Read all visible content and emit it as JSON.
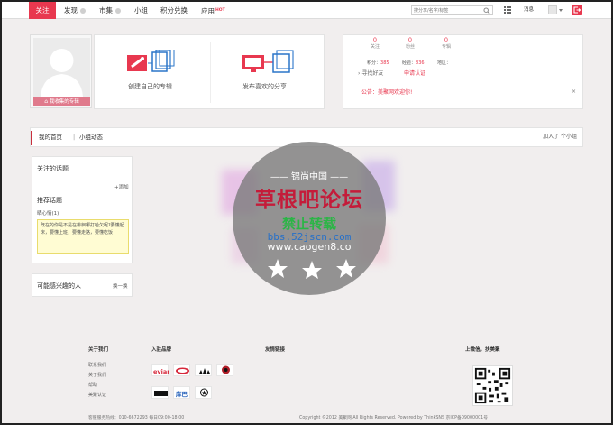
{
  "nav": {
    "items": [
      {
        "label": "关注",
        "active": true
      },
      {
        "label": "发现",
        "active": false
      },
      {
        "label": "市集",
        "active": false
      },
      {
        "label": "小组",
        "active": false
      },
      {
        "label": "积分兑换",
        "active": false
      },
      {
        "label": "应用",
        "active": false,
        "badge": "HOT"
      }
    ],
    "search": {
      "placeholder": "搜分享/名字/标签"
    },
    "messages_label": "消息",
    "icons": {
      "search": "search-icon",
      "grid": "grid-icon",
      "exit": "exit-icon"
    }
  },
  "profile": {
    "collect_button": "我收集的专辑",
    "actions": [
      {
        "label": "创建自己的专辑",
        "icon": "album-create-icon"
      },
      {
        "label": "发布喜欢的分享",
        "icon": "share-publish-icon"
      }
    ],
    "stats": [
      {
        "value": "0",
        "label": "关注"
      },
      {
        "value": "0",
        "label": "粉丝"
      },
      {
        "value": "0",
        "label": "专辑"
      }
    ],
    "points_label": "积分：",
    "points_value": "385",
    "exp_label": "经验：",
    "exp_value": "836",
    "region_label": "地区：",
    "find_friends": "寻找好友",
    "apply_cert": "申请认证",
    "notice": "公告：美聚网欢迎你!",
    "notice_close": "×"
  },
  "tabs": {
    "items": [
      "我的首页",
      "小组动态"
    ],
    "separator": "|",
    "joined": "加入了 个小组"
  },
  "topics_widget": {
    "title": "关注的话题",
    "add": "+添加",
    "recommended_title": "推荐话题",
    "sub": "晒心情(1)",
    "tip": "既在的你是不是在徘徊哪打哈欠呢?要懂起床，要懂上班，要懂走路，要懂吃饭"
  },
  "interest_widget": {
    "title": "可能感兴趣的人",
    "next": "换一换"
  },
  "footer": {
    "about_title": "关于我们",
    "about_links": [
      "联系我们",
      "关于我们",
      "帮助",
      "美聚认证"
    ],
    "brands_title": "入驻品牌",
    "brands": [
      "evian",
      "brand-car",
      "adidas",
      "BACARDI",
      "brand-4",
      "库巴",
      "CONVERSE"
    ],
    "friends_title": "友情链接",
    "app_title": "上微信，扶美聚",
    "hotline": "客服服务热线：010-6672293  每日09:00-18:00",
    "copyright": "Copyright ©2012 美聚网 All Rights Reserved. Powered by ThinkSNS  京ICP备09000001号"
  },
  "watermark": {
    "top": "—— 锦尚中国 ——",
    "main": "草根吧论坛",
    "sub": "禁止转载",
    "url1": "bbs.52jscn.com",
    "url2": "www.caogen8.co"
  },
  "colors": {
    "accent": "#e8384f",
    "notice": "#e8384f",
    "tip_bg": "#fffcd3"
  }
}
